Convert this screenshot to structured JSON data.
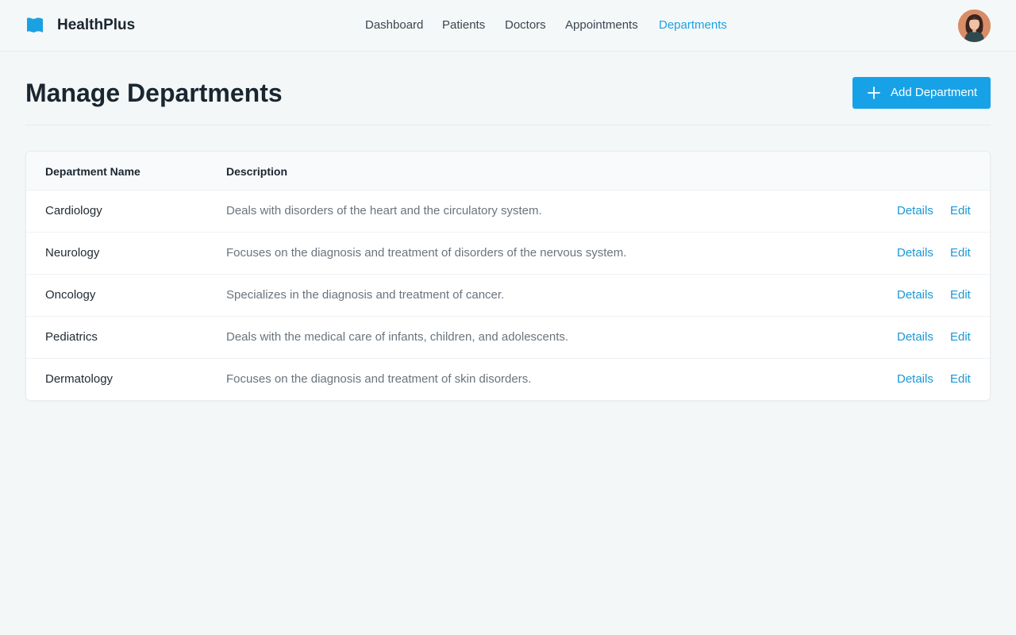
{
  "app": {
    "name": "HealthPlus",
    "logo_icon": "flag-icon",
    "accent_color": "#17a2e8"
  },
  "nav": {
    "items": [
      {
        "label": "Dashboard",
        "active": false
      },
      {
        "label": "Patients",
        "active": false
      },
      {
        "label": "Doctors",
        "active": false
      },
      {
        "label": "Appointments",
        "active": false
      },
      {
        "label": "Departments",
        "active": true
      }
    ]
  },
  "user": {
    "avatar_icon": "user-avatar"
  },
  "page": {
    "title": "Manage Departments",
    "add_button_label": "Add Department",
    "add_button_icon": "plus-icon"
  },
  "table": {
    "columns": [
      "Department Name",
      "Description"
    ],
    "rows": [
      {
        "name": "Cardiology",
        "description": "Deals with disorders of the heart and the circulatory system.",
        "details_label": "Details",
        "edit_label": "Edit"
      },
      {
        "name": "Neurology",
        "description": "Focuses on the diagnosis and treatment of disorders of the nervous system.",
        "details_label": "Details",
        "edit_label": "Edit"
      },
      {
        "name": "Oncology",
        "description": "Specializes in the diagnosis and treatment of cancer.",
        "details_label": "Details",
        "edit_label": "Edit"
      },
      {
        "name": "Pediatrics",
        "description": "Deals with the medical care of infants, children, and adolescents.",
        "details_label": "Details",
        "edit_label": "Edit"
      },
      {
        "name": "Dermatology",
        "description": "Focuses on the diagnosis and treatment of skin disorders.",
        "details_label": "Details",
        "edit_label": "Edit"
      }
    ]
  }
}
